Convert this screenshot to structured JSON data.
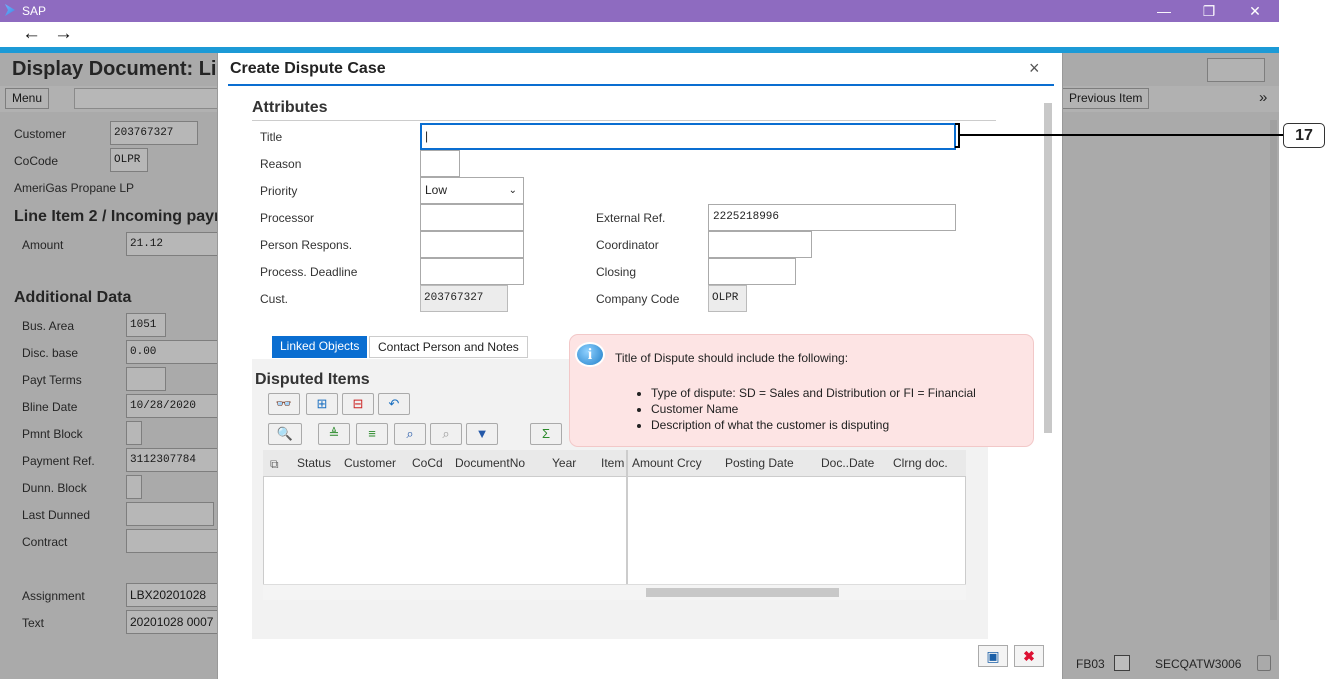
{
  "window": {
    "title": "SAP",
    "minimize": "—",
    "restore": "❐",
    "close": "✕"
  },
  "nav": {
    "back": "←",
    "forward": "→"
  },
  "background": {
    "title": "Display Document: Li",
    "menu_label": "Menu",
    "previous_item": "Previous Item",
    "more": "»",
    "customer_label": "Customer",
    "customer_value": "203767327",
    "cocode_label": "CoCode",
    "cocode_value": "OLPR",
    "company_name": "AmeriGas Propane LP",
    "line_item_heading": "Line Item 2 / Incoming payı",
    "amount_label": "Amount",
    "amount_value": "21.12",
    "additional_heading": "Additional Data",
    "fields": [
      {
        "label": "Bus. Area",
        "value": "1051"
      },
      {
        "label": "Disc. base",
        "value": "0.00"
      },
      {
        "label": "Payt Terms",
        "value": ""
      },
      {
        "label": "Bline Date",
        "value": "10/28/2020"
      },
      {
        "label": "Pmnt Block",
        "value": ""
      },
      {
        "label": "Payment Ref.",
        "value": "3112307784"
      },
      {
        "label": "Dunn. Block",
        "value": ""
      },
      {
        "label": "Last Dunned",
        "value": ""
      },
      {
        "label": "Contract",
        "value": ""
      }
    ],
    "assignment_label": "Assignment",
    "assignment_value": "LBX20201028",
    "text_label": "Text",
    "text_value": "20201028 0007",
    "tcode": "FB03",
    "system": "SECQATW3006"
  },
  "dialog": {
    "title": "Create Dispute Case",
    "close": "×",
    "attributes_heading": "Attributes",
    "title_label": "Title",
    "title_value": "|",
    "reason_label": "Reason",
    "reason_value": "",
    "priority_label": "Priority",
    "priority_value": "Low",
    "processor_label": "Processor",
    "processor_value": "",
    "person_label": "Person Respons.",
    "person_value": "",
    "deadline_label": "Process. Deadline",
    "deadline_value": "",
    "cust_label": "Cust.",
    "cust_value": "203767327",
    "extref_label": "External Ref.",
    "extref_value": "2225218996",
    "coordinator_label": "Coordinator",
    "coordinator_value": "",
    "closing_label": "Closing",
    "closing_value": "",
    "company_label": "Company Code",
    "company_value": "OLPR",
    "tabs": [
      "Linked Objects",
      "Contact Person and Notes"
    ],
    "disputed_heading": "Disputed Items",
    "columns_left": [
      "Status",
      "Customer",
      "CoCd",
      "DocumentNo",
      "Year",
      "Item"
    ],
    "columns_right": [
      "Amount",
      "Crcy",
      "Posting Date",
      "Doc..Date",
      "Clrng doc."
    ]
  },
  "info": {
    "intro": "Title of Dispute should include the following:",
    "bullets": [
      "Type of dispute: SD = Sales and Distribution or FI = Financial",
      "Customer Name",
      "Description of what the customer is disputing"
    ]
  },
  "callout": "17"
}
